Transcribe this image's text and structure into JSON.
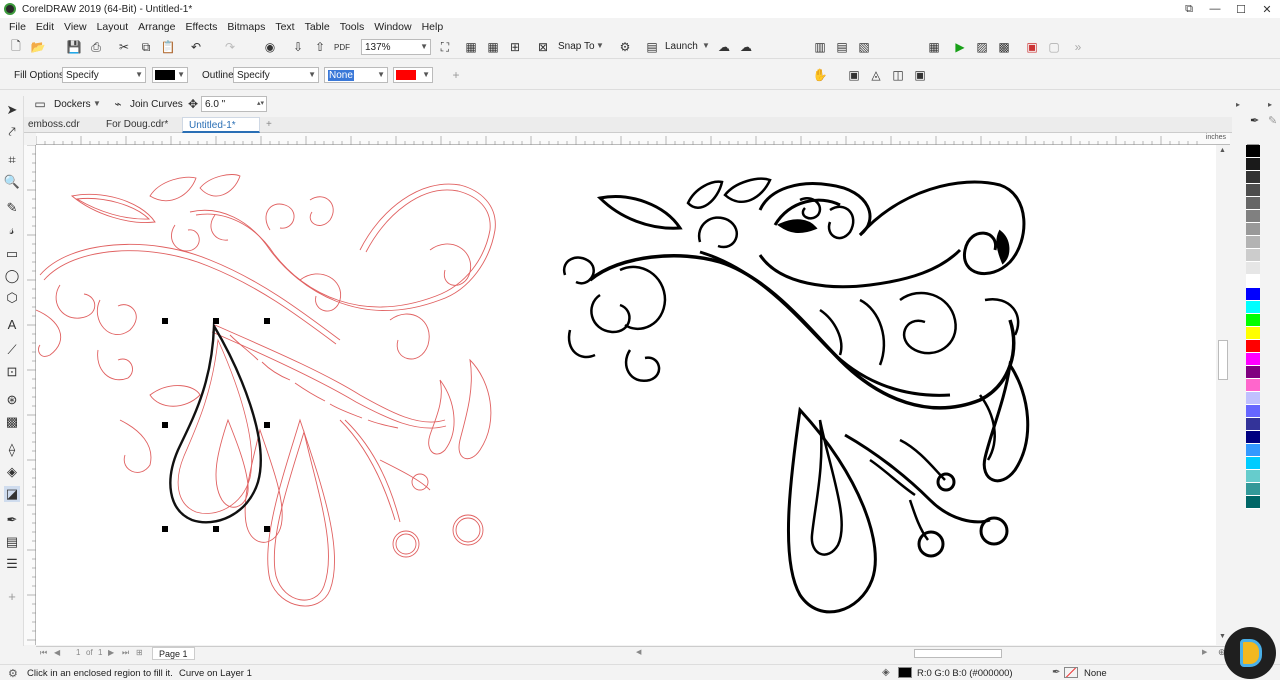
{
  "window": {
    "title": "CorelDRAW 2019 (64-Bit) - Untitled-1*"
  },
  "menu": [
    "File",
    "Edit",
    "View",
    "Layout",
    "Arrange",
    "Effects",
    "Bitmaps",
    "Text",
    "Table",
    "Tools",
    "Window",
    "Help"
  ],
  "toolbar": {
    "zoom": "137%",
    "snap_to": "Snap To",
    "launch": "Launch"
  },
  "property_bar": {
    "fill_options_label": "Fill Options:",
    "fill_options_value": "Specify",
    "fill_color": "#000000",
    "outline_label": "Outline:",
    "outline_value": "Specify",
    "outline_width": "None",
    "outline_color": "#ff0000"
  },
  "property_bar2": {
    "dockers": "Dockers",
    "join_curves": "Join Curves",
    "distance": "6.0 \""
  },
  "tabs": [
    {
      "label": "emboss.cdr"
    },
    {
      "label": "For Doug.cdr*"
    },
    {
      "label": "Untitled-1*"
    }
  ],
  "ruler": {
    "units": "inches"
  },
  "page_nav": {
    "current": "1",
    "of": "of",
    "total": "1",
    "page_label": "Page 1"
  },
  "status": {
    "hint": "Click in an enclosed region to fill it.",
    "object": "Curve on Layer 1",
    "fill_readout": "R:0 G:0 B:0 (#000000)",
    "outline_readout": "None"
  },
  "colors": {
    "accent": "#2a6fb5",
    "outline_red": "#e06060",
    "palette": [
      "#000000",
      "#1a1a1a",
      "#333333",
      "#4d4d4d",
      "#666666",
      "#808080",
      "#999999",
      "#b3b3b3",
      "#cccccc",
      "#e6e6e6",
      "#ffffff",
      "#0000ff",
      "#00ffff",
      "#00ff00",
      "#ffff00",
      "#ff0000",
      "#ff00ff",
      "#800080",
      "#ff66cc",
      "#c0c0ff",
      "#6666ff",
      "#333399",
      "#000080",
      "#3399ff",
      "#00ccff",
      "#66cccc",
      "#339999",
      "#006666"
    ]
  }
}
